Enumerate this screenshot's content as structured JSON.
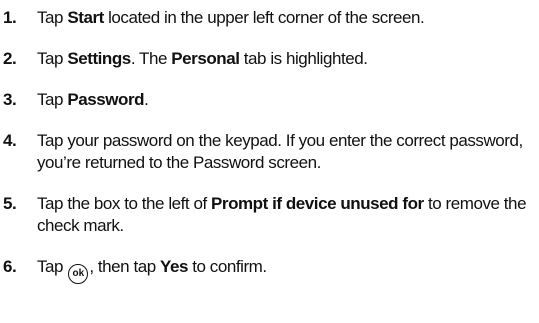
{
  "steps": [
    {
      "number": "1.",
      "parts": [
        {
          "t": "Tap "
        },
        {
          "t": "Start",
          "b": true
        },
        {
          "t": " located in the upper left corner of the screen."
        }
      ]
    },
    {
      "number": "2.",
      "parts": [
        {
          "t": "Tap "
        },
        {
          "t": "Settings",
          "b": true
        },
        {
          "t": ". The "
        },
        {
          "t": "Personal",
          "b": true
        },
        {
          "t": " tab is highlighted."
        }
      ]
    },
    {
      "number": "3.",
      "parts": [
        {
          "t": "Tap "
        },
        {
          "t": "Password",
          "b": true
        },
        {
          "t": "."
        }
      ]
    },
    {
      "number": "4.",
      "parts": [
        {
          "t": "Tap your password on the keypad. If you enter the correct password, you’re returned to the Password screen."
        }
      ]
    },
    {
      "number": "5.",
      "parts": [
        {
          "t": "Tap the box to the left of "
        },
        {
          "t": "Prompt if device unused for",
          "b": true
        },
        {
          "t": " to remove the check mark."
        }
      ]
    },
    {
      "number": "6.",
      "parts": [
        {
          "t": "Tap "
        },
        {
          "icon": "ok-icon",
          "label": "ok"
        },
        {
          "t": ", then tap "
        },
        {
          "t": "Yes",
          "b": true
        },
        {
          "t": " to confirm."
        }
      ]
    }
  ]
}
